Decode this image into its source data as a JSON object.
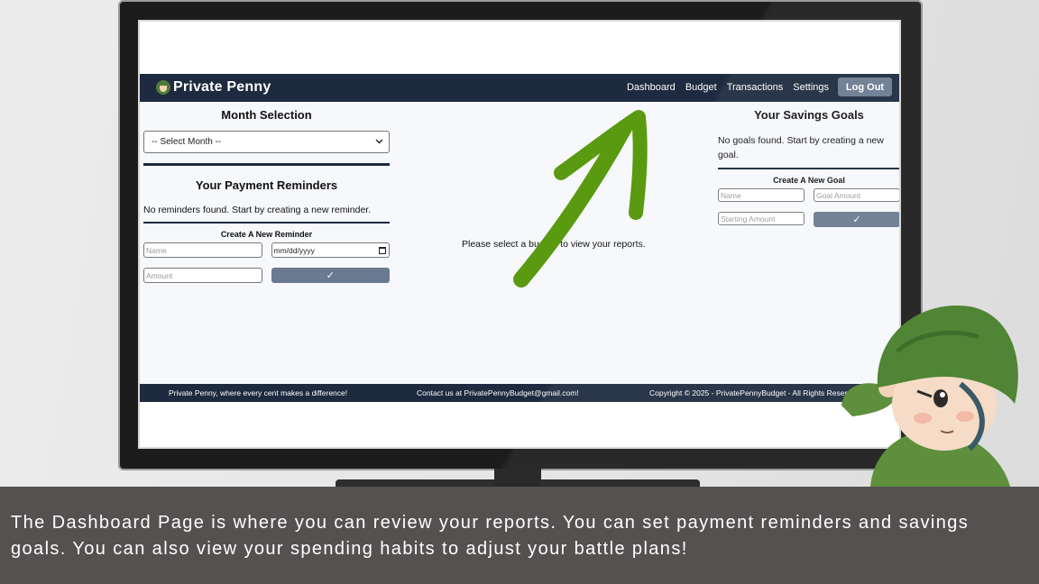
{
  "app": {
    "brand": "Private Penny",
    "nav": [
      "Dashboard",
      "Budget",
      "Transactions",
      "Settings"
    ],
    "logout": "Log Out"
  },
  "month_selection": {
    "title": "Month Selection",
    "select_value": "-- Select Month --"
  },
  "reminders": {
    "title": "Your Payment Reminders",
    "empty": "No reminders found. Start by creating a new reminder.",
    "create_title": "Create A New Reminder",
    "name_placeholder": "Name",
    "date_placeholder": "mm/dd/yyyy",
    "amount_placeholder": "Amount",
    "submit": "✓"
  },
  "center": {
    "message": "Please select a budget to view your reports."
  },
  "goals": {
    "title": "Your Savings Goals",
    "empty": "No goals found. Start by creating a new goal.",
    "create_title": "Create A New Goal",
    "name_placeholder": "Name",
    "goal_amount_placeholder": "Goal Amount",
    "starting_amount_placeholder": "Starting Amount",
    "submit": "✓"
  },
  "footer": {
    "tagline": "Private Penny, where every cent makes a difference!",
    "contact": "Contact us at PrivatePennyBudget@gmail.com!",
    "copyright": "Copyright © 2025 - PrivatePennyBudget - All Rights Reserved"
  },
  "caption": "The Dashboard Page is where you can review your reports. You can set payment reminders and savings goals. You can also view your spending habits to adjust your battle plans!",
  "colors": {
    "navy": "#1d2a3f",
    "button": "#6a7a91",
    "arrow": "#5a9a10",
    "caption_bg": "#545150"
  }
}
